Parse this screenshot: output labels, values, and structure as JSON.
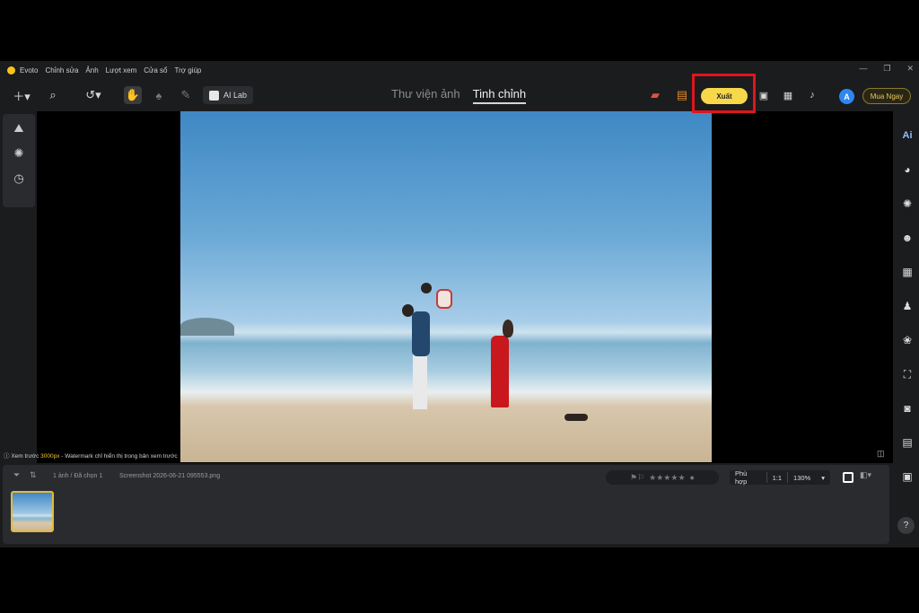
{
  "menu": {
    "app_name": "Evoto",
    "items": [
      "Chỉnh sửa",
      "Ảnh",
      "Lượt xem",
      "Cửa sổ",
      "Trợ giúp"
    ]
  },
  "window_controls": [
    "—",
    "❐",
    "✕"
  ],
  "toolbar": {
    "ai_lab_label": "AI Lab",
    "tab_library": "Thư viện ảnh",
    "tab_edit": "Tinh chỉnh",
    "export_label": "Xuất",
    "avatar_letter": "A",
    "buy_label": "Mua Ngay"
  },
  "canvas": {
    "preview_prefix": "Xem trước ",
    "preview_size": "3000px",
    "preview_suffix": " - Watermark chỉ hiển thị trong bản xem trước"
  },
  "filmstrip": {
    "count_label": "1 ảnh / Đã chọn 1",
    "filename": "Screenshot 2026-06-21 095553.png",
    "fit_label": "Phù hợp",
    "ratio_label": "1:1",
    "zoom_label": "130%"
  },
  "right_tools": [
    "ai-icon",
    "palette-icon",
    "filter-icon",
    "face-icon",
    "grid-icon",
    "shirt-icon",
    "paw-icon",
    "crop-icon",
    "camera-icon",
    "folder-eye-icon",
    "person-box-icon"
  ],
  "colors": {
    "accent_yellow": "#f7d84a",
    "highlight_red": "#e0151b",
    "avatar_blue": "#2f86f0"
  }
}
